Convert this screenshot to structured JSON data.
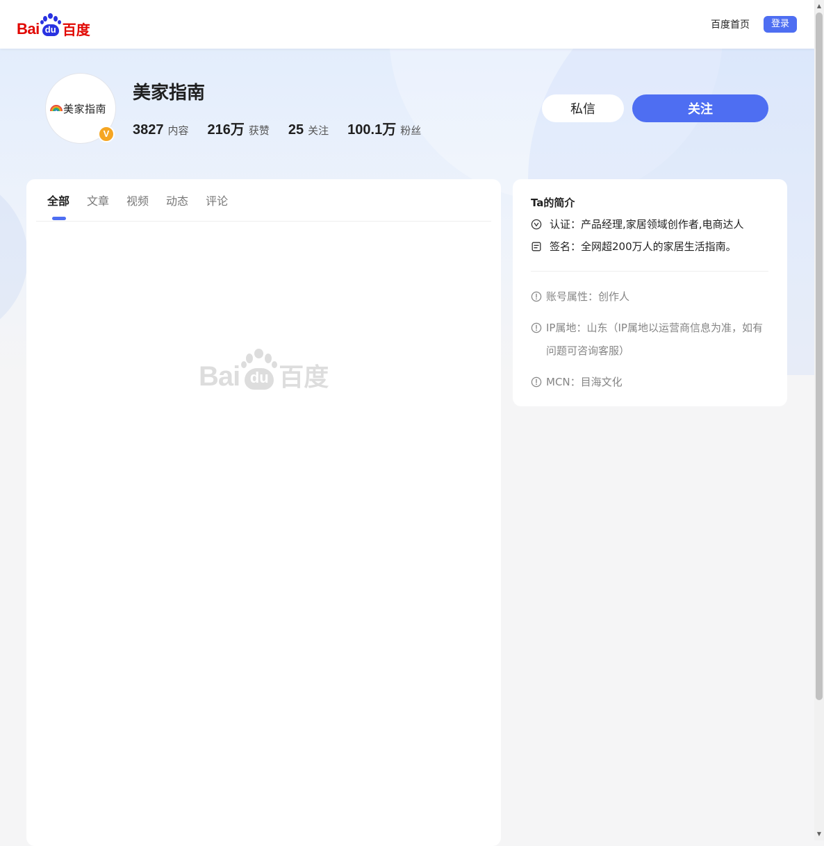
{
  "header": {
    "logo": {
      "latin_left": "Bai",
      "latin_paw": "du",
      "chinese": "百度"
    },
    "home_link": "百度首页",
    "login_button": "登录"
  },
  "profile": {
    "avatar_text": "美家指南",
    "verified_badge": "V",
    "name": "美家指南",
    "stats": [
      {
        "value": "3827",
        "label": "内容"
      },
      {
        "value": "216万",
        "label": "获赞"
      },
      {
        "value": "25",
        "label": "关注"
      },
      {
        "value": "100.1万",
        "label": "粉丝"
      }
    ],
    "message_button": "私信",
    "follow_button": "关注"
  },
  "tabs": [
    {
      "label": "全部",
      "active": true
    },
    {
      "label": "文章",
      "active": false
    },
    {
      "label": "视频",
      "active": false
    },
    {
      "label": "动态",
      "active": false
    },
    {
      "label": "评论",
      "active": false
    }
  ],
  "placeholder": {
    "latin_left": "Bai",
    "latin_paw": "du",
    "chinese": "百度"
  },
  "intro": {
    "title": "Ta的简介",
    "verification": "认证：产品经理,家居领域创作者,电商达人",
    "signature": "签名：全网超200万人的家居生活指南。",
    "meta": [
      {
        "icon": "info-icon",
        "text": "账号属性：创作人"
      },
      {
        "icon": "info-icon",
        "text": "IP属地：山东（IP属地以运营商信息为准，如有问题可咨询客服）"
      },
      {
        "icon": "info-icon",
        "text": "MCN：目海文化"
      }
    ]
  },
  "colors": {
    "accent": "#4e6ef2",
    "brand_red": "#e10601",
    "brand_blue": "#2932e1",
    "badge_gold": "#f5a623"
  }
}
